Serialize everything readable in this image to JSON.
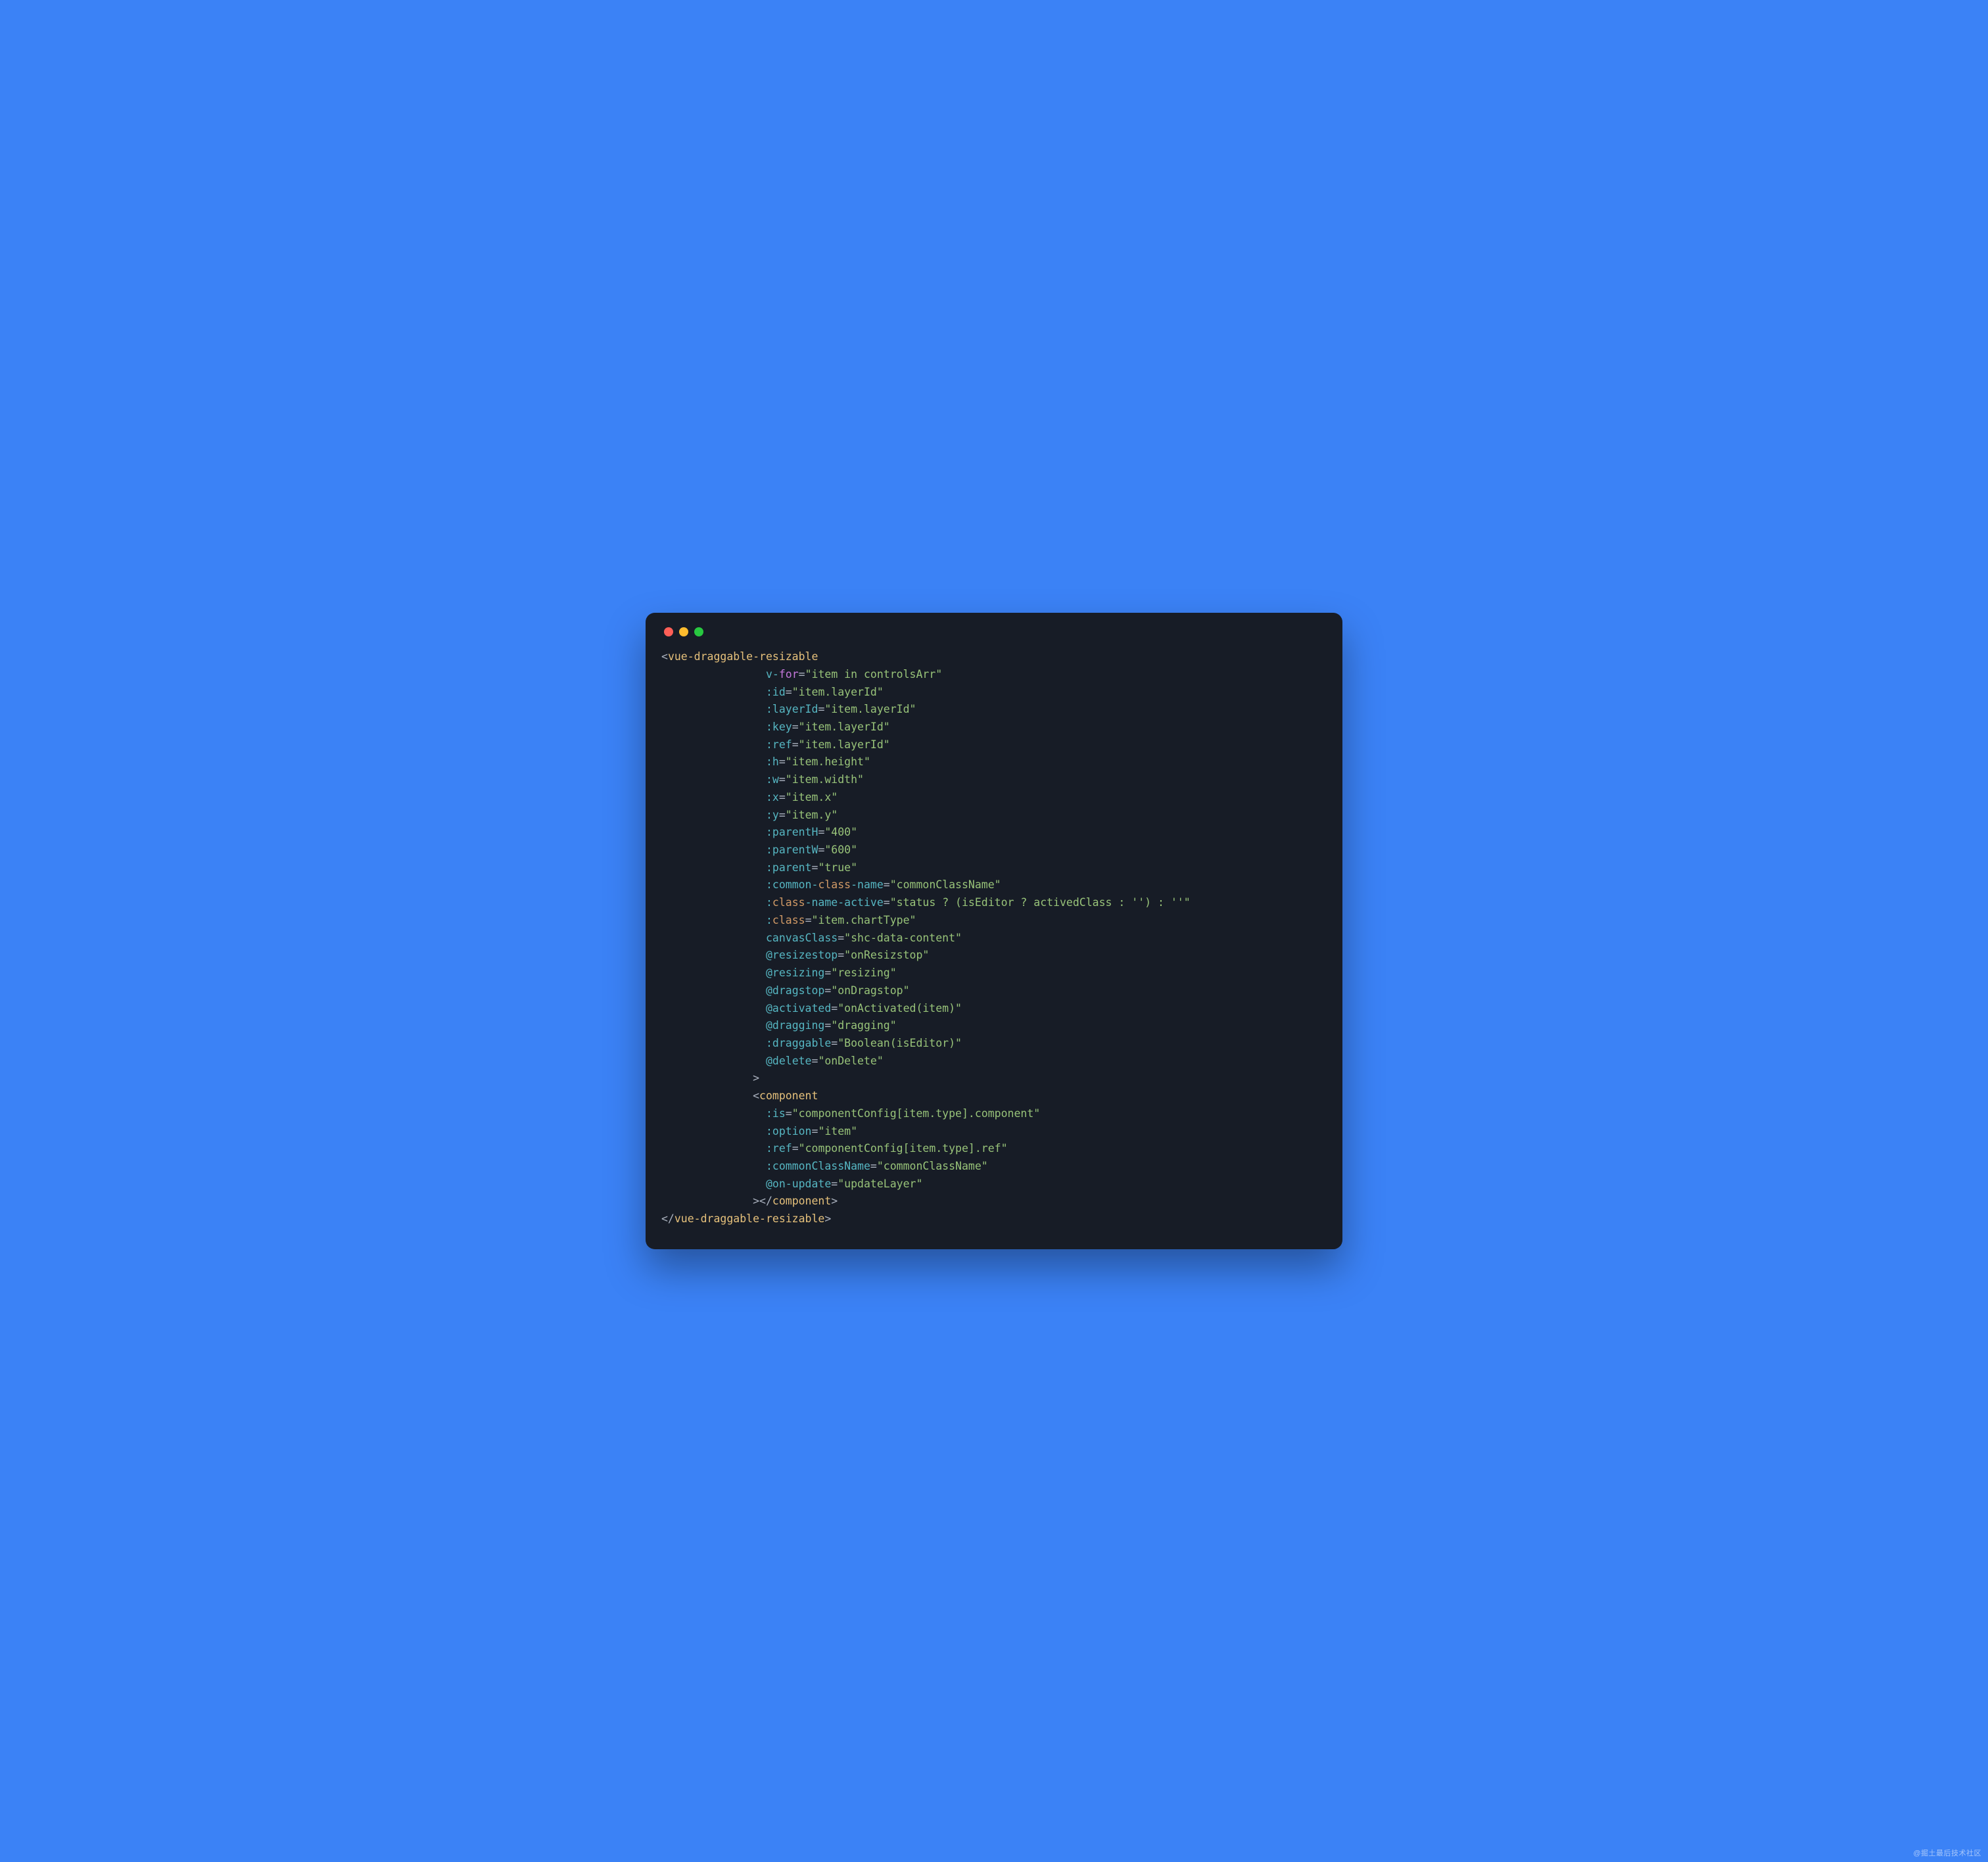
{
  "watermark": "@掘土最后技术社区",
  "colors": {
    "background": "#3b82f6",
    "editor_bg": "#171c26",
    "traffic_red": "#ff5f57",
    "traffic_yellow": "#febc2e",
    "traffic_green": "#28c840",
    "punctuation": "#abb2bf",
    "tag": "#e5c07b",
    "attribute": "#56b6c2",
    "keyword": "#c678dd",
    "class_attr": "#d19a66",
    "string": "#98c379"
  },
  "code": {
    "open_tag": "<",
    "close_tag": ">",
    "end_open": "</",
    "tag_vdr": "vue-draggable-resizable",
    "tag_component": "component",
    "indent_attr": "                ",
    "indent_comp": "              ",
    "indent_comp_attr": "                ",
    "attrs": {
      "vfor_prefix": "v-",
      "vfor_key": "for",
      "vfor_eq": "=",
      "vfor_val": "\"item in controlsArr\"",
      "id": ":id",
      "id_val": "\"item.layerId\"",
      "layerId": ":layerId",
      "layerId_val": "\"item.layerId\"",
      "key": ":key",
      "key_val": "\"item.layerId\"",
      "ref": ":ref",
      "ref_val": "\"item.layerId\"",
      "h": ":h",
      "h_val": "\"item.height\"",
      "w": ":w",
      "w_val": "\"item.width\"",
      "x": ":x",
      "x_val": "\"item.x\"",
      "y": ":y",
      "y_val": "\"item.y\"",
      "parentH": ":parentH",
      "parentH_val": "\"400\"",
      "parentW": ":parentW",
      "parentW_val": "\"600\"",
      "parent": ":parent",
      "parent_val": "\"true\"",
      "ccn_pre": ":common-",
      "ccn_mid": "class",
      "ccn_post": "-name",
      "ccn_val": "\"commonClassName\"",
      "cna_pre": ":",
      "cna_class": "class",
      "cna_post": "-name-active",
      "cna_val": "\"status ? (isEditor ? activedClass : '') : ''\"",
      "class_pre": ":",
      "class_mid": "class",
      "class_val": "\"item.chartType\"",
      "canvasClass": "canvasClass",
      "canvasClass_val": "\"shc-data-content\"",
      "resizestop": "@resizestop",
      "resizestop_val": "\"onResizstop\"",
      "resizing": "@resizing",
      "resizing_val": "\"resizing\"",
      "dragstop": "@dragstop",
      "dragstop_val": "\"onDragstop\"",
      "activated": "@activated",
      "activated_val": "\"onActivated(item)\"",
      "dragging": "@dragging",
      "dragging_val": "\"dragging\"",
      "draggable": ":draggable",
      "draggable_val": "\"Boolean(isEditor)\"",
      "delete": "@delete",
      "delete_val": "\"onDelete\""
    },
    "comp_attrs": {
      "is": ":is",
      "is_val": "\"componentConfig[item.type].component\"",
      "option": ":option",
      "option_val": "\"item\"",
      "ref": ":ref",
      "ref_val": "\"componentConfig[item.type].ref\"",
      "ccn": ":commonClassName",
      "ccn_val": "\"commonClassName\"",
      "onupdate": "@on-update",
      "onupdate_val": "\"updateLayer\""
    }
  }
}
